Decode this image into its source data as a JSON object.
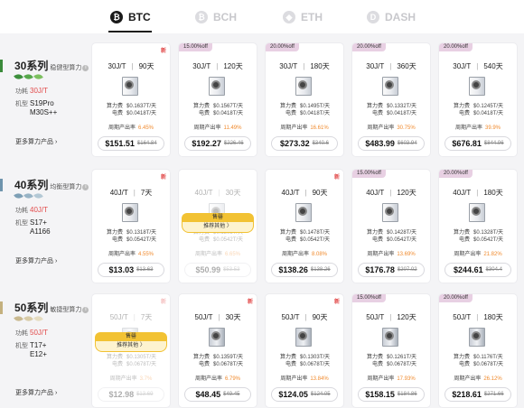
{
  "tabs": [
    {
      "label": "BTC",
      "symbol": "₿",
      "active": true
    },
    {
      "label": "BCH",
      "symbol": "₿",
      "active": false
    },
    {
      "label": "ETH",
      "symbol": "◆",
      "active": false
    },
    {
      "label": "DASH",
      "symbol": "D",
      "active": false
    }
  ],
  "labels": {
    "compute_fee": "算力费",
    "power_fee": "电费",
    "rate": "周期产出率",
    "power_key": "功耗",
    "model_key": "机型",
    "more": "更多算力产品",
    "new": "新",
    "soldout_top": "售罄",
    "soldout_bottom": "推荐其他 〉"
  },
  "series": [
    {
      "title": "30系列",
      "subtitle": "稳健型算力",
      "power": "30J/T",
      "model": [
        "S19Pro",
        "M30S++"
      ],
      "leaf_colors": [
        "#3c8f3c",
        "#56a74b",
        "#7cc05f"
      ],
      "cards": [
        {
          "tag": "",
          "new": true,
          "spec_power": "30J/T",
          "days": "90天",
          "compute_fee": "$0.1637T/天",
          "power_fee": "$0.0418T/天",
          "rate": "6.45%",
          "price": "$151.51",
          "old_price": "$164.84",
          "soldout": false
        },
        {
          "tag": "15.00%off",
          "new": false,
          "spec_power": "30J/T",
          "days": "120天",
          "compute_fee": "$0.1567T/天",
          "power_fee": "$0.0418T/天",
          "rate": "11.49%",
          "price": "$192.27",
          "old_price": "$226.46",
          "soldout": false
        },
        {
          "tag": "20.00%off",
          "new": false,
          "spec_power": "30J/T",
          "days": "180天",
          "compute_fee": "$0.1495T/天",
          "power_fee": "$0.0418T/天",
          "rate": "16.61%",
          "price": "$273.32",
          "old_price": "$340.6",
          "soldout": false
        },
        {
          "tag": "20.00%off",
          "new": false,
          "spec_power": "30J/T",
          "days": "360天",
          "compute_fee": "$0.1332T/天",
          "power_fee": "$0.0418T/天",
          "rate": "30.75%",
          "price": "$483.99",
          "old_price": "$603.94",
          "soldout": false
        },
        {
          "tag": "20.00%off",
          "new": false,
          "spec_power": "30J/T",
          "days": "540天",
          "compute_fee": "$0.1245T/天",
          "power_fee": "$0.0418T/天",
          "rate": "39.9%",
          "price": "$676.81",
          "old_price": "$844.96",
          "soldout": false
        }
      ]
    },
    {
      "title": "40系列",
      "subtitle": "均衡型算力",
      "power": "40J/T",
      "model": [
        "S17+",
        "A1166"
      ],
      "leaf_colors": [
        "#7d9fb5",
        "#97b3c5",
        "#b3c8d5"
      ],
      "cards": [
        {
          "tag": "",
          "new": true,
          "spec_power": "40J/T",
          "days": "7天",
          "compute_fee": "$0.1318T/天",
          "power_fee": "$0.0542T/天",
          "rate": "4.55%",
          "price": "$13.03",
          "old_price": "$13.63",
          "soldout": false
        },
        {
          "tag": "",
          "new": false,
          "spec_power": "40J/T",
          "days": "30天",
          "compute_fee": "$0.1305T/天",
          "power_fee": "$0.0542T/天",
          "rate": "6.65%",
          "price": "$50.99",
          "old_price": "$53.53",
          "soldout": true
        },
        {
          "tag": "",
          "new": true,
          "spec_power": "40J/T",
          "days": "90天",
          "compute_fee": "$0.1478T/天",
          "power_fee": "$0.0542T/天",
          "rate": "8.08%",
          "price": "$138.26",
          "old_price": "$138.26",
          "soldout": false
        },
        {
          "tag": "15.00%off",
          "new": false,
          "spec_power": "40J/T",
          "days": "120天",
          "compute_fee": "$0.1428T/天",
          "power_fee": "$0.0542T/天",
          "rate": "13.69%",
          "price": "$176.78",
          "old_price": "$207.02",
          "soldout": false
        },
        {
          "tag": "20.00%off",
          "new": false,
          "spec_power": "40J/T",
          "days": "180天",
          "compute_fee": "$0.1328T/天",
          "power_fee": "$0.0542T/天",
          "rate": "21.82%",
          "price": "$244.61",
          "old_price": "$304.4",
          "soldout": false
        }
      ]
    },
    {
      "title": "50系列",
      "subtitle": "敏捷型算力",
      "power": "50J/T",
      "model": [
        "T17+",
        "E12+"
      ],
      "leaf_colors": [
        "#c9b98f",
        "#d8cba6",
        "#e5dcc0"
      ],
      "cards": [
        {
          "tag": "",
          "new": true,
          "spec_power": "50J/T",
          "days": "7天",
          "compute_fee": "$0.1305T/天",
          "power_fee": "$0.0678T/天",
          "rate": "3.7%",
          "price": "$12.98",
          "old_price": "$13.69",
          "soldout": true
        },
        {
          "tag": "",
          "new": true,
          "spec_power": "50J/T",
          "days": "30天",
          "compute_fee": "$0.1359T/天",
          "power_fee": "$0.0678T/天",
          "rate": "6.79%",
          "price": "$48.45",
          "old_price": "$49.45",
          "soldout": false
        },
        {
          "tag": "",
          "new": true,
          "spec_power": "50J/T",
          "days": "90天",
          "compute_fee": "$0.1303T/天",
          "power_fee": "$0.0678T/天",
          "rate": "13.84%",
          "price": "$124.05",
          "old_price": "$124.05",
          "soldout": false
        },
        {
          "tag": "15.00%off",
          "new": false,
          "spec_power": "50J/T",
          "days": "120天",
          "compute_fee": "$0.1261T/天",
          "power_fee": "$0.0678T/天",
          "rate": "17.93%",
          "price": "$158.15",
          "old_price": "$184.86",
          "soldout": false
        },
        {
          "tag": "20.00%off",
          "new": false,
          "spec_power": "50J/T",
          "days": "180天",
          "compute_fee": "$0.1176T/天",
          "power_fee": "$0.0678T/天",
          "rate": "26.12%",
          "price": "$218.61",
          "old_price": "$271.66",
          "soldout": false
        }
      ]
    }
  ]
}
